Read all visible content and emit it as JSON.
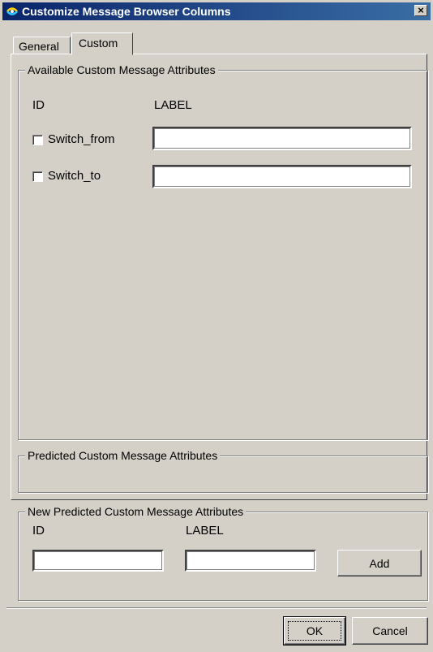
{
  "window": {
    "title": "Customize Message Browser Columns",
    "icon": "app-icon",
    "close_label": "×"
  },
  "tabs": [
    {
      "label": "General",
      "selected": false
    },
    {
      "label": "Custom",
      "selected": true
    }
  ],
  "available_group": {
    "legend": "Available Custom Message Attributes",
    "col_id": "ID",
    "col_label": "LABEL",
    "rows": [
      {
        "id": "Switch_from",
        "checked": false,
        "label_value": ""
      },
      {
        "id": "Switch_to",
        "checked": false,
        "label_value": ""
      }
    ]
  },
  "predicted_group": {
    "legend": "Predicted Custom Message Attributes"
  },
  "new_group": {
    "legend": "New Predicted Custom Message Attributes",
    "col_id": "ID",
    "col_label": "LABEL",
    "id_value": "",
    "label_value": "",
    "add_label": "Add"
  },
  "footer": {
    "ok_label": "OK",
    "cancel_label": "Cancel"
  },
  "colors": {
    "face": "#d4d0c8",
    "title_start": "#0a246a",
    "title_end": "#3a6ea5"
  }
}
